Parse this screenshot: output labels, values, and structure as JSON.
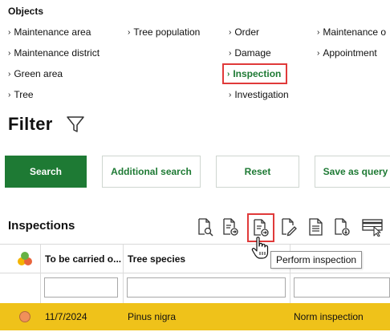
{
  "objects": {
    "title": "Objects",
    "items": [
      {
        "label": "Maintenance area"
      },
      {
        "label": "Maintenance district"
      },
      {
        "label": "Green area"
      },
      {
        "label": "Tree"
      },
      {
        "label": "Tree population"
      },
      {
        "label": "Order"
      },
      {
        "label": "Damage"
      },
      {
        "label": "Inspection",
        "active": true
      },
      {
        "label": "Investigation"
      },
      {
        "label": "Maintenance o"
      },
      {
        "label": "Appointment"
      }
    ]
  },
  "filter": {
    "title": "Filter",
    "buttons": {
      "search": "Search",
      "additional_search": "Additional search",
      "reset": "Reset",
      "save_as_query": "Save as query"
    }
  },
  "inspections": {
    "title": "Inspections",
    "toolbar_icons": [
      "view-document-icon",
      "document-forward-icon",
      "perform-inspection-icon",
      "edit-document-icon",
      "document-list-icon",
      "document-download-icon",
      "table-select-icon"
    ],
    "tooltip": "Perform inspection",
    "columns": [
      {
        "label": "To be carried o..."
      },
      {
        "label": "Tree species"
      }
    ],
    "rows": [
      {
        "status_color": "#f0905a",
        "date": "11/7/2024",
        "species": "Pinus nigra",
        "type": "Norm inspection"
      }
    ]
  },
  "colors": {
    "accent": "#1e7a34",
    "highlight_border": "#e03a3a",
    "selected_row": "#efc21a"
  }
}
